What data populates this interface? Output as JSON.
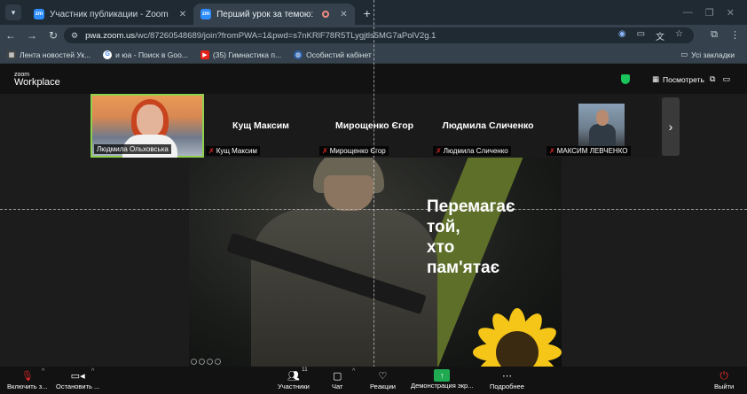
{
  "browser": {
    "tabs": [
      {
        "title": "Участник публикации - Zoom",
        "active": false,
        "favicon": "zoom"
      },
      {
        "title": "Перший урок за темою: ",
        "active": true,
        "favicon": "zoom"
      }
    ],
    "url_host": "pwa.zoom.us",
    "url_path": "/wc/87260548689/join?fromPWA=1&pwd=s7nKRlF78R5TLygjtls5MG7aPolV2g.1",
    "bookmarks": [
      {
        "label": "Лента новостей Ук...",
        "icon": "grid-icon"
      },
      {
        "label": "и юа - Поиск в Goo...",
        "icon": "google-icon"
      },
      {
        "label": "(35) Гимнастика п...",
        "icon": "youtube-icon"
      },
      {
        "label": "Особистий кабінет",
        "icon": "globe-icon"
      }
    ],
    "all_bookmarks": "Усі закладки"
  },
  "zoom": {
    "logo_top": "zoom",
    "logo_bottom": "Workplace",
    "view_label": "Посмотреть",
    "participants": [
      {
        "tile_name": "",
        "label": "Людмила Ольховська",
        "muted": false,
        "video": true,
        "active": true
      },
      {
        "tile_name": "Кущ Максим",
        "label": "Кущ Максим",
        "muted": true,
        "video": false
      },
      {
        "tile_name": "Мирощенко Єгор",
        "label": "Мирощенко Єгор",
        "muted": true,
        "video": false
      },
      {
        "tile_name": "Людмила Сличенко",
        "label": "Людмила Сличенко",
        "muted": true,
        "video": false
      },
      {
        "tile_name": "",
        "label": "МАКСИМ ЛЕВЧЕНКО",
        "muted": true,
        "video": true
      }
    ],
    "slide": {
      "slogan_lines": [
        "Перемагає",
        "той,",
        "хто",
        "пам'ятає"
      ]
    },
    "toolbar": {
      "audio": "Включить з...",
      "video": "Остановить ...",
      "participants": "Участники",
      "participants_count": "11",
      "chat": "Чат",
      "reactions": "Реакции",
      "share": "Демонстрация экр...",
      "more": "Подробнее",
      "leave": "Выйти"
    },
    "colors": {
      "active_speaker": "#8fd14f",
      "share_green": "#1faa52",
      "leave_red": "#e02828",
      "slide_stripe": "#5e6f2a"
    }
  }
}
